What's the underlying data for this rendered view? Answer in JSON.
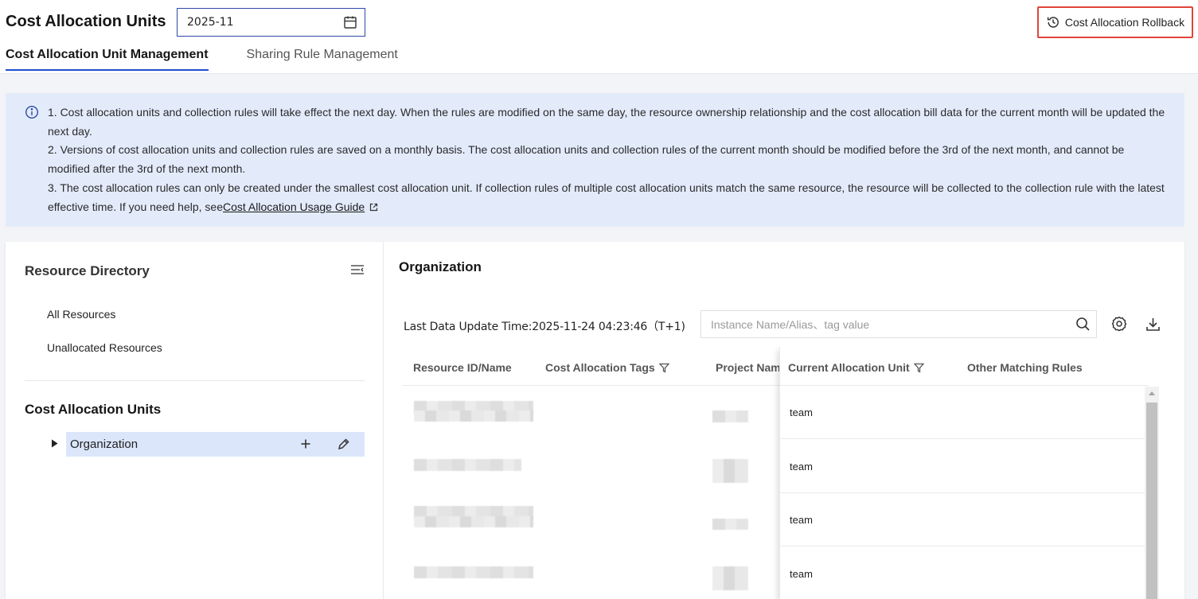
{
  "header": {
    "title": "Cost Allocation Units",
    "date_value": "2025-11",
    "rollback_label": "Cost Allocation Rollback"
  },
  "tabs": [
    {
      "label": "Cost Allocation Unit Management",
      "active": true
    },
    {
      "label": "Sharing Rule Management",
      "active": false
    }
  ],
  "notice": {
    "line1": "1. Cost allocation units and collection rules will take effect the next day. When the rules are modified on the same day, the resource ownership relationship and the cost allocation bill data for the current month will be updated the next day.",
    "line2": "2. Versions of cost allocation units and collection rules are saved on a monthly basis. The cost allocation units and collection rules of the current month should be modified before the 3rd of the next month, and cannot be modified after the 3rd of the next month.",
    "line3": "3. The cost allocation rules can only be created under the smallest cost allocation unit. If collection rules of multiple cost allocation units match the same resource, the resource will be collected to the collection rule with the latest effective time. If you need help, see",
    "guide_link": "Cost Allocation Usage Guide"
  },
  "sidebar": {
    "resource_directory_title": "Resource Directory",
    "items": [
      {
        "label": "All Resources"
      },
      {
        "label": "Unallocated Resources"
      }
    ],
    "cost_units_title": "Cost Allocation Units",
    "tree": [
      {
        "label": "Organization",
        "selected": true
      }
    ]
  },
  "main": {
    "title": "Organization",
    "update_time_label": "Last Data Update Time:",
    "update_time_value": "2025-11-24 04:23:46（T+1)",
    "search_placeholder": "Instance Name/Alias、tag value",
    "columns": [
      {
        "label": "Resource ID/Name"
      },
      {
        "label": "Cost Allocation Tags"
      },
      {
        "label": "Project Name"
      },
      {
        "label": "Current Allocation Unit"
      },
      {
        "label": "Other Matching Rules"
      }
    ],
    "rows": [
      {
        "current_allocation_unit": "team"
      },
      {
        "current_allocation_unit": "team"
      },
      {
        "current_allocation_unit": "team"
      },
      {
        "current_allocation_unit": "team"
      }
    ]
  },
  "colors": {
    "accent": "#1f4fd1",
    "notice_bg": "#e3ebfb",
    "highlight_border": "#e0443a",
    "selected_row": "#dbe6fb"
  },
  "icons": [
    "calendar-icon",
    "history-icon",
    "info-icon",
    "external-link-icon",
    "collapse-menu-icon",
    "caret-right-icon",
    "plus-icon",
    "edit-icon",
    "search-icon",
    "gear-icon",
    "download-icon",
    "filter-icon"
  ]
}
